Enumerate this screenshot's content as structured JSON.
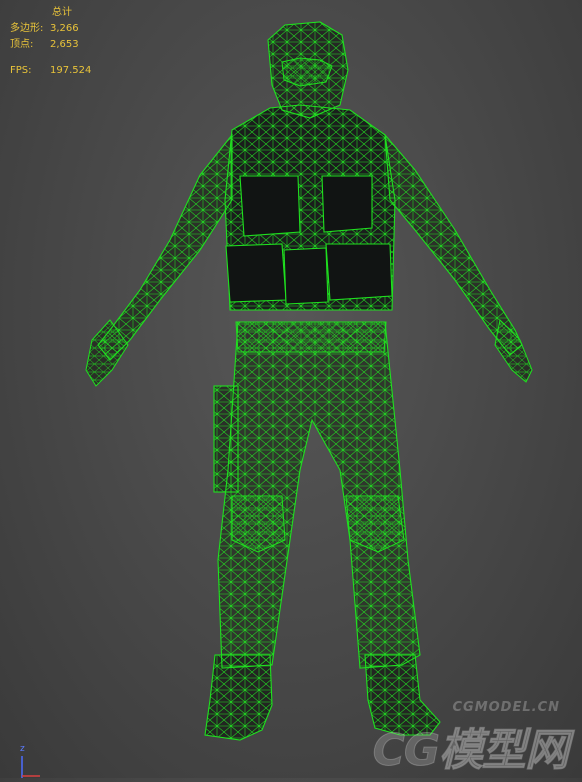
{
  "stats": {
    "header": "总计",
    "polygons_label": "多边形:",
    "polygons_value": "3,266",
    "vertices_label": "顶点:",
    "vertices_value": "2,653",
    "fps_label": "FPS:",
    "fps_value": "197.524"
  },
  "watermark": {
    "url": "CGMODEL.CN",
    "logo": "CG模型网"
  },
  "axis": {
    "z_label": "z"
  },
  "colors": {
    "wire": "#1fe01f",
    "stats_text": "#e8c33a",
    "background": "#4a4a4a"
  }
}
